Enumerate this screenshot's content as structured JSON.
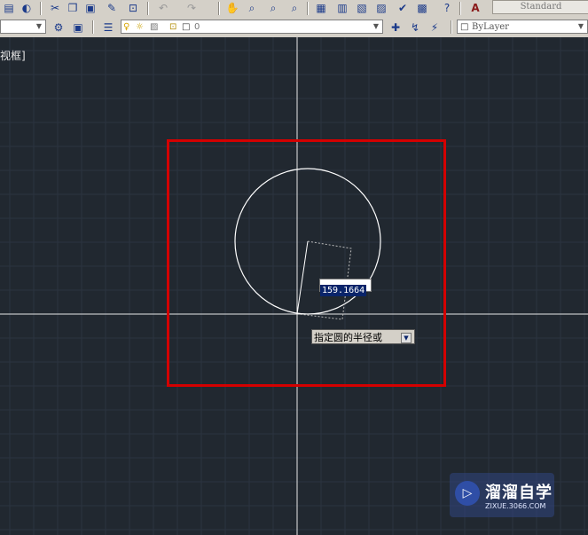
{
  "toolbar": {
    "text_style": "Standard",
    "layer_value": "0",
    "color_value": "ByLayer",
    "icons": [
      "new-icon",
      "open-icon",
      "cut-icon",
      "copy-icon",
      "paste-icon",
      "match-properties-icon",
      "block-editor-icon",
      "undo-icon",
      "redo-icon",
      "pan-icon",
      "zoom-realtime-icon",
      "zoom-window-icon",
      "zoom-previous-icon",
      "properties-icon",
      "design-center-icon",
      "tool-palettes-icon",
      "sheet-set-icon",
      "markup-icon",
      "quickcalc-icon",
      "help-icon",
      "text-style-icon"
    ],
    "layer_icons": [
      "layer-manager-icon",
      "light-bulb-icon",
      "sun-icon",
      "lock-icon",
      "color-swatch-icon",
      "make-current-icon",
      "layer-previous-icon",
      "layer-states-icon"
    ]
  },
  "canvas": {
    "corner_label": "视框]",
    "radius_value": "159.1664",
    "prompt_text": "指定圆的半径或",
    "highlight_color": "#d40000"
  },
  "watermark": {
    "title": "溜溜自学",
    "subtitle": "ZIXUE.3066.COM"
  }
}
